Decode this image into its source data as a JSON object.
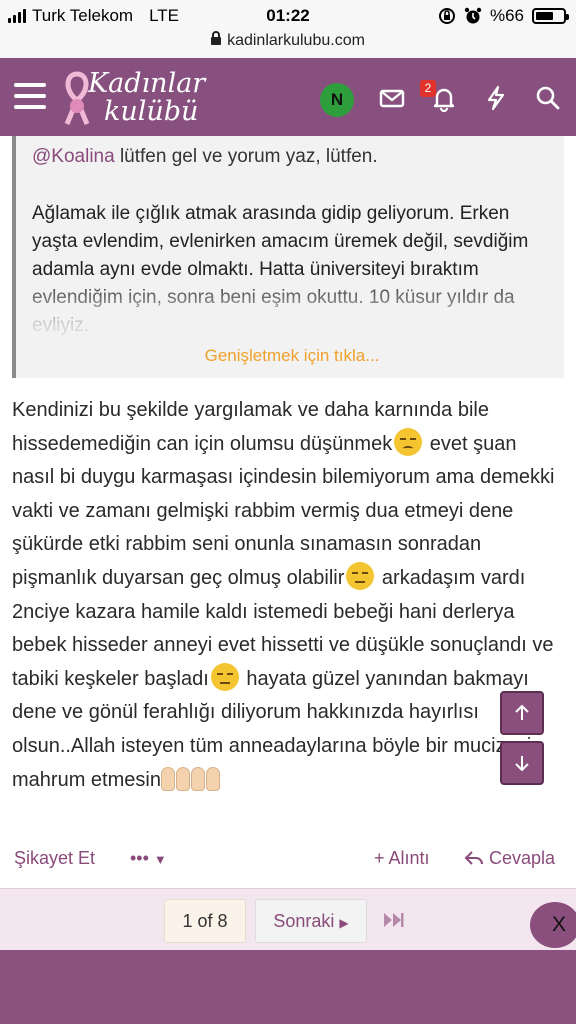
{
  "status_bar": {
    "carrier": "Turk Telekom",
    "network": "LTE",
    "time": "01:22",
    "battery": "%66",
    "battery_level": 0.66
  },
  "url_bar": {
    "domain": "kadinlarkulubu.com"
  },
  "header": {
    "logo_line1": "Kadınlar",
    "logo_line2": "kulübü",
    "avatar_initial": "N",
    "notification_count": "2",
    "colors": {
      "header_bg": "#87507f",
      "avatar_bg": "#2e9e3c",
      "badge_bg": "#e0322b"
    },
    "icons": [
      "menu-icon",
      "mail-icon",
      "bell-icon",
      "bolt-icon",
      "search-icon"
    ]
  },
  "quote": {
    "mention": "@Koalina",
    "lead": " lütfen gel ve yorum yaz, lütfen.",
    "text": "Ağlamak ile çığlık atmak arasında gidip geliyorum. Erken yaşta evlendim, evlenirken amacım üremek değil, sevdiğim adamla aynı evde olmaktı. Hatta üniversiteyi bıraktım evlendiğim için, sonra beni eşim okuttu. 10 küsur yıldır da evliyiz.",
    "expand_label": "Genişletmek için tıkla..."
  },
  "post": {
    "p1": "Kendinizi bu şekilde yargılamak ve daha karnında bile hissedemediğin can için olumsu düşünmek",
    "p2": " evet şuan nasıl bi duygu karmaşası içindesin bilemiyorum ama demekki vakti ve zamanı gelmişki rabbim vermiş dua etmeyi dene şükürde etki rabbim seni onunla sınamasın sonradan pişmanlık duyarsan geç olmuş olabilir",
    "p3": " arkadaşım vardı 2nciye kazara hamile kaldı istemedi bebeği hani derlerya bebek hisseder anneyi evet hissetti ve düşükle sonuçlandı ve tabiki keşkeler başladı",
    "p4": " hayata güzel yanından bakmayı dene ve gönül ferahlığı diliyorum hakkınızda hayırlısı olsun..Allah isteyen tüm anneadaylarına böyle bir mucizeyi mahrum etmesin",
    "emojis": [
      "disappointed-face",
      "expressionless-face",
      "expressionless-face",
      "raised-hands",
      "raised-hands"
    ]
  },
  "actions": {
    "report": "Şikayet Et",
    "more": "•••",
    "quote": "+ Alıntı",
    "reply": "Cevapla"
  },
  "pagination": {
    "current": "1 of 8",
    "next": "Sonraki",
    "close": "X"
  }
}
